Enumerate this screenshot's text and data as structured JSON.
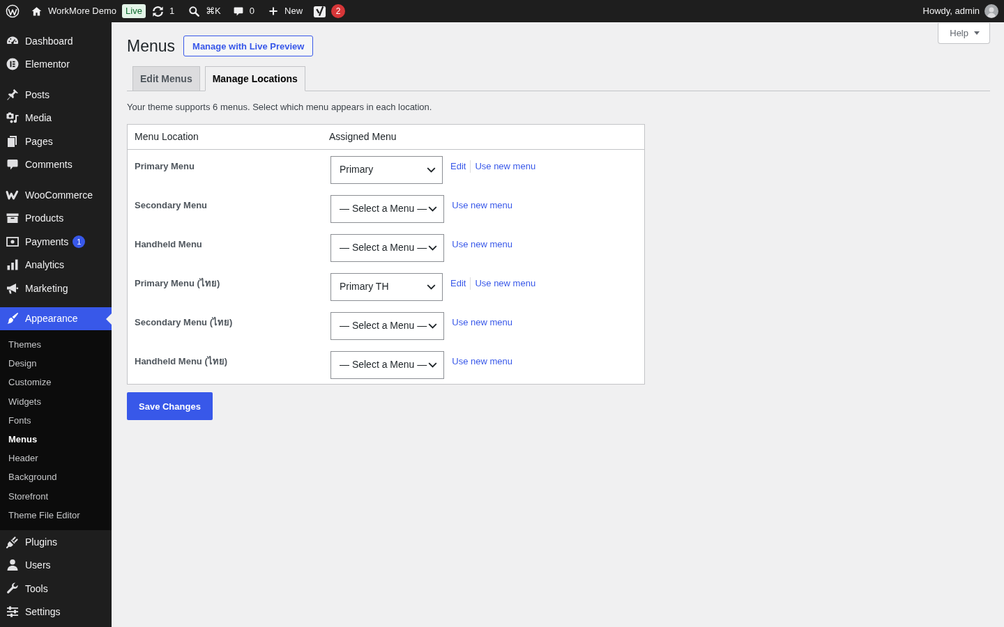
{
  "admin_bar": {
    "site_name": "WorkMore Demo",
    "environment": "Live",
    "updates": "1",
    "search_shortcut": "⌘K",
    "comments": "0",
    "new_label": "New",
    "seo_count": "2",
    "greeting": "Howdy, admin"
  },
  "sidebar": {
    "groups": [
      [
        {
          "label": "Dashboard",
          "selected": false
        },
        {
          "label": "Elementor",
          "selected": false
        }
      ],
      [
        {
          "label": "Posts",
          "selected": false
        },
        {
          "label": "Media",
          "selected": false
        },
        {
          "label": "Pages",
          "selected": false
        },
        {
          "label": "Comments",
          "selected": false
        }
      ],
      [
        {
          "label": "WooCommerce",
          "selected": false
        },
        {
          "label": "Products",
          "selected": false
        },
        {
          "label": "Payments",
          "selected": false,
          "badge": "1"
        },
        {
          "label": "Analytics",
          "selected": false
        },
        {
          "label": "Marketing",
          "selected": false
        }
      ],
      [
        {
          "label": "Appearance",
          "selected": true,
          "children": [
            {
              "label": "Themes",
              "selected": false
            },
            {
              "label": "Design",
              "selected": false
            },
            {
              "label": "Customize",
              "selected": false
            },
            {
              "label": "Widgets",
              "selected": false
            },
            {
              "label": "Fonts",
              "selected": false
            },
            {
              "label": "Menus",
              "selected": true
            },
            {
              "label": "Header",
              "selected": false
            },
            {
              "label": "Background",
              "selected": false
            },
            {
              "label": "Storefront",
              "selected": false
            },
            {
              "label": "Theme File Editor",
              "selected": false
            }
          ]
        },
        {
          "label": "Plugins",
          "selected": false
        },
        {
          "label": "Users",
          "selected": false
        },
        {
          "label": "Tools",
          "selected": false
        },
        {
          "label": "Settings",
          "selected": false
        }
      ]
    ]
  },
  "page": {
    "title": "Menus",
    "title_action": "Manage with Live Preview",
    "help": "Help",
    "tabs": [
      {
        "label": "Edit Menus",
        "selected": false
      },
      {
        "label": "Manage Locations",
        "selected": true
      }
    ],
    "description": "Your theme supports 6 menus. Select which menu appears in each location.",
    "table": {
      "columns": [
        "Menu Location",
        "Assigned Menu"
      ],
      "rows": [
        {
          "location": "Primary Menu",
          "assigned": "Primary",
          "edit_link": "Edit",
          "new_menu_link": "Use new menu"
        },
        {
          "location": "Secondary Menu",
          "assigned": "— Select a Menu —",
          "new_menu_link": "Use new menu"
        },
        {
          "location": "Handheld Menu",
          "assigned": "— Select a Menu —",
          "new_menu_link": "Use new menu"
        },
        {
          "location": "Primary Menu (ไทย)",
          "assigned": "Primary TH",
          "edit_link": "Edit",
          "new_menu_link": "Use new menu"
        },
        {
          "location": "Secondary Menu (ไทย)",
          "assigned": "— Select a Menu —",
          "new_menu_link": "Use new menu"
        },
        {
          "location": "Handheld Menu (ไทย)",
          "assigned": "— Select a Menu —",
          "new_menu_link": "Use new menu"
        }
      ]
    },
    "save_button": "Save Changes"
  }
}
